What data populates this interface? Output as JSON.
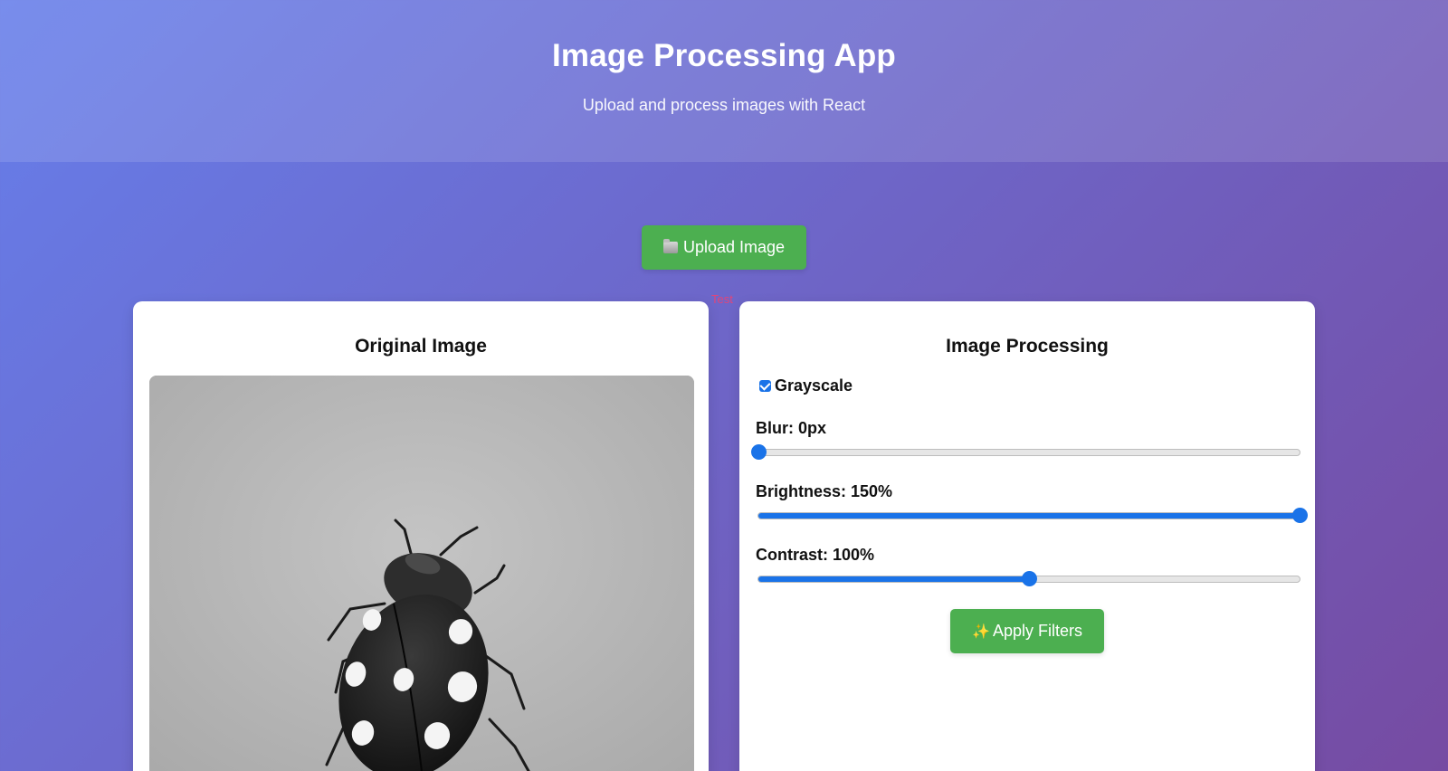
{
  "header": {
    "title": "Image Processing App",
    "subtitle": "Upload and process images with React"
  },
  "upload": {
    "label": "Upload Image",
    "icon": "folder-icon"
  },
  "stray_text": "Test",
  "original_panel": {
    "title": "Original Image"
  },
  "processing_panel": {
    "title": "Image Processing",
    "grayscale": {
      "label": "Grayscale",
      "checked": true
    },
    "sliders": [
      {
        "label": "Blur: 0px",
        "value": 0,
        "min": 0,
        "max": 10
      },
      {
        "label": "Brightness: 150%",
        "value": 150,
        "min": 50,
        "max": 150
      },
      {
        "label": "Contrast: 100%",
        "value": 100,
        "min": 50,
        "max": 150
      }
    ],
    "apply": {
      "label": "Apply Filters",
      "icon": "sparkles-icon"
    }
  },
  "colors": {
    "accent": "#4caf50",
    "slider": "#1a73e8",
    "gradient_start": "#667eea",
    "gradient_end": "#764ba2"
  }
}
